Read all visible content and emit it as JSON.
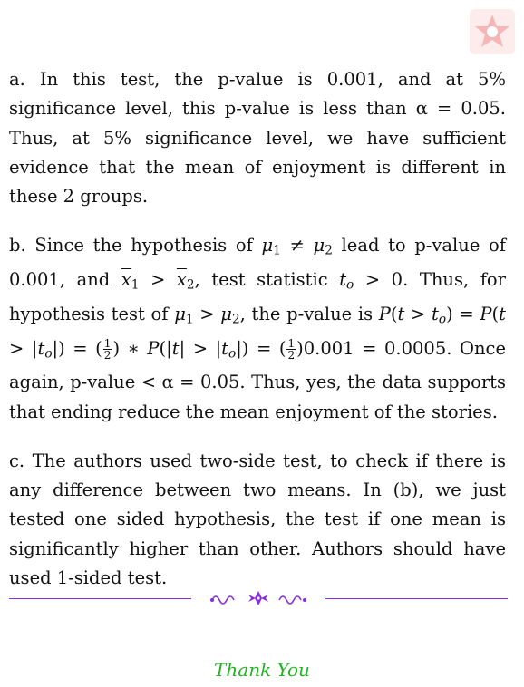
{
  "paragraph_a": {
    "text": "a. In this test, the p-value is 0.001, and at 5% significance level, this p-value is less than α = 0.05. Thus, at 5% significance level, we have sufficient evidence that the mean of enjoyment is different in these 2 groups."
  },
  "paragraph_b": {
    "text1": "b. Since the hypothesis of ",
    "text2": " lead to p-value of 0.001, and ",
    "text3": ", test statistic ",
    "text4": ". Thus, for hypothesis test of ",
    "text5": ", the p-value is ",
    "text6": ". Once again, p-value < α = 0.05. Thus, yes, the data supports that ending reduce the mean enjoyment of the stories."
  },
  "paragraph_c": {
    "text": "c. The authors used two-side test, to check if there is any difference between two means. In (b), we just tested one sided hypothesis, the test if one mean is significantly higher than other. Authors should have used 1-sided test."
  },
  "footer": {
    "thanks": "Thank You"
  },
  "colors": {
    "divider": "#8a2be2",
    "thanks": "#22b522",
    "logo_bg": "#fdecec"
  }
}
